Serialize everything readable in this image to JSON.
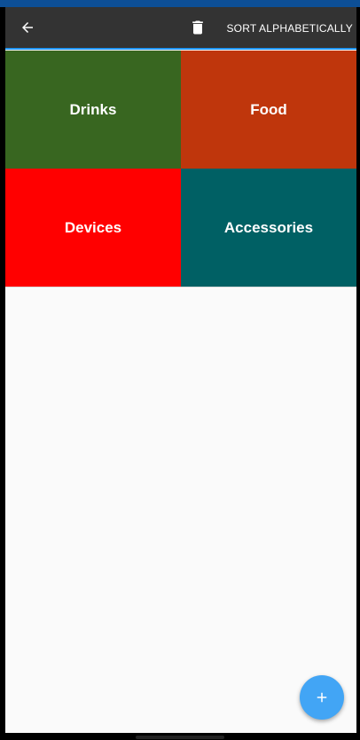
{
  "appbar": {
    "back_icon": "arrow-left-icon",
    "delete_icon": "trash-icon",
    "sort_label": "SORT ALPHABETICALLY",
    "accent_color": "#2196f3",
    "background_color": "#333333"
  },
  "categories": [
    {
      "label": "Drinks",
      "color": "#386620"
    },
    {
      "label": "Food",
      "color": "#bf360c"
    },
    {
      "label": "Devices",
      "color": "#ff0000"
    },
    {
      "label": "Accessories",
      "color": "#006064"
    }
  ],
  "fab": {
    "icon": "plus-icon",
    "color": "#42a5f5"
  }
}
